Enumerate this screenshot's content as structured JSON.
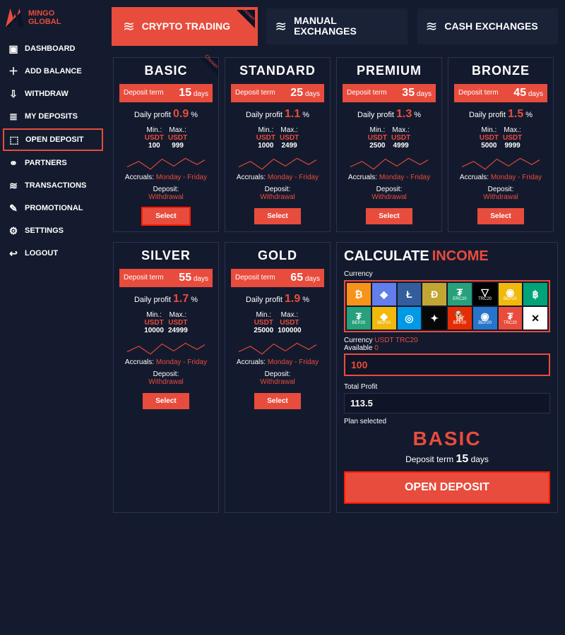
{
  "brand": {
    "line1": "MINGO",
    "line2": "GLOBAL"
  },
  "sidebar": [
    {
      "label": "DASHBOARD"
    },
    {
      "label": "ADD BALANCE"
    },
    {
      "label": "WITHDRAW"
    },
    {
      "label": "MY DEPOSITS"
    },
    {
      "label": "OPEN DEPOSIT",
      "active": true
    },
    {
      "label": "PARTNERS"
    },
    {
      "label": "TRANSACTIONS"
    },
    {
      "label": "PROMOTIONAL"
    },
    {
      "label": "SETTINGS"
    },
    {
      "label": "LOGOUT"
    }
  ],
  "tabs": {
    "crypto": "CRYPTO TRADING",
    "manual": "MANUAL EXCHANGES",
    "cash": "CASH EXCHANGES",
    "chosen": "Chosen"
  },
  "plan_common": {
    "term_label": "Deposit term",
    "days_word": "days",
    "daily_profit_label": "Daily profit",
    "pct_sign": "%",
    "min_label": "Min.:",
    "max_label": "Max.:",
    "usdt": "USDT",
    "accruals_label": "Accruals:",
    "accruals_value": "Monday - Friday",
    "deposit_label": "Deposit:",
    "deposit_value": "Withdrawal",
    "select": "Select"
  },
  "plans": [
    {
      "name": "BASIC",
      "days": "15",
      "profit": "0.9",
      "min": "100",
      "max": "999",
      "chosen": true
    },
    {
      "name": "STANDARD",
      "days": "25",
      "profit": "1.1",
      "min": "1000",
      "max": "2499"
    },
    {
      "name": "PREMIUM",
      "days": "35",
      "profit": "1.3",
      "min": "2500",
      "max": "4999"
    },
    {
      "name": "BRONZE",
      "days": "45",
      "profit": "1.5",
      "min": "5000",
      "max": "9999"
    },
    {
      "name": "SILVER",
      "days": "55",
      "profit": "1.7",
      "min": "10000",
      "max": "24999"
    },
    {
      "name": "GOLD",
      "days": "65",
      "profit": "1.9",
      "min": "25000",
      "max": "100000"
    }
  ],
  "calc": {
    "title_calc": "CALCULATE",
    "title_income": "INCOME",
    "currency_label": "Currency",
    "currencies": [
      {
        "sym": "₿",
        "sub": "",
        "bg": "#f7931a"
      },
      {
        "sym": "◆",
        "sub": "",
        "bg": "#627eea"
      },
      {
        "sym": "Ł",
        "sub": "",
        "bg": "#345d9d"
      },
      {
        "sym": "Ð",
        "sub": "",
        "bg": "#c2a633"
      },
      {
        "sym": "₮",
        "sub": "ERC20",
        "bg": "#26a17b"
      },
      {
        "sym": "▽",
        "sub": "TRC20",
        "bg": "#000000"
      },
      {
        "sym": "◉",
        "sub": "BEP20",
        "bg": "#f0b90b"
      },
      {
        "sym": "฿",
        "sub": "",
        "bg": "#00a478"
      },
      {
        "sym": "₮",
        "sub": "BEP20",
        "bg": "#26a17b"
      },
      {
        "sym": "◆",
        "sub": "BEP20",
        "bg": "#f0b90b"
      },
      {
        "sym": "◎",
        "sub": "",
        "bg": "#0099e5"
      },
      {
        "sym": "✦",
        "sub": "",
        "bg": "#080808"
      },
      {
        "sym": "🐕",
        "sub": "BEP20",
        "bg": "#e42d04"
      },
      {
        "sym": "◉",
        "sub": "BEP20",
        "bg": "#2775ca"
      },
      {
        "sym": "₮",
        "sub": "TRC20",
        "bg": "#e84c3d"
      },
      {
        "sym": "✕",
        "sub": "",
        "bg": "#ffffff"
      }
    ],
    "currency_line_label": "Currency",
    "currency_line_value": "USDT TRC20",
    "available_label": "Available",
    "available_value": "0",
    "amount": "100",
    "total_profit_label": "Total Profit",
    "total_profit_value": "113.5",
    "plan_selected_label": "Plan selected",
    "plan_selected_name": "BASIC",
    "deposit_term_label": "Deposit term",
    "deposit_term_days": "15",
    "deposit_term_days_word": "days",
    "open_deposit": "OPEN DEPOSIT"
  }
}
